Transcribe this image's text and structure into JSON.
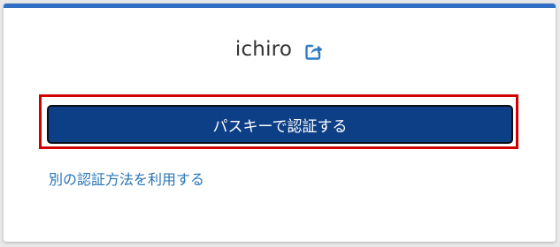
{
  "user": {
    "name": "ichiro",
    "edit_icon": "share-edit-icon"
  },
  "actions": {
    "passkey_button_label": "パスキーで認証する",
    "other_method_link": "別の認証方法を利用する"
  },
  "colors": {
    "top_accent": "#2f6fc4",
    "button_bg": "#0d3f87",
    "highlight_border": "#d00000",
    "link": "#2774b6"
  }
}
